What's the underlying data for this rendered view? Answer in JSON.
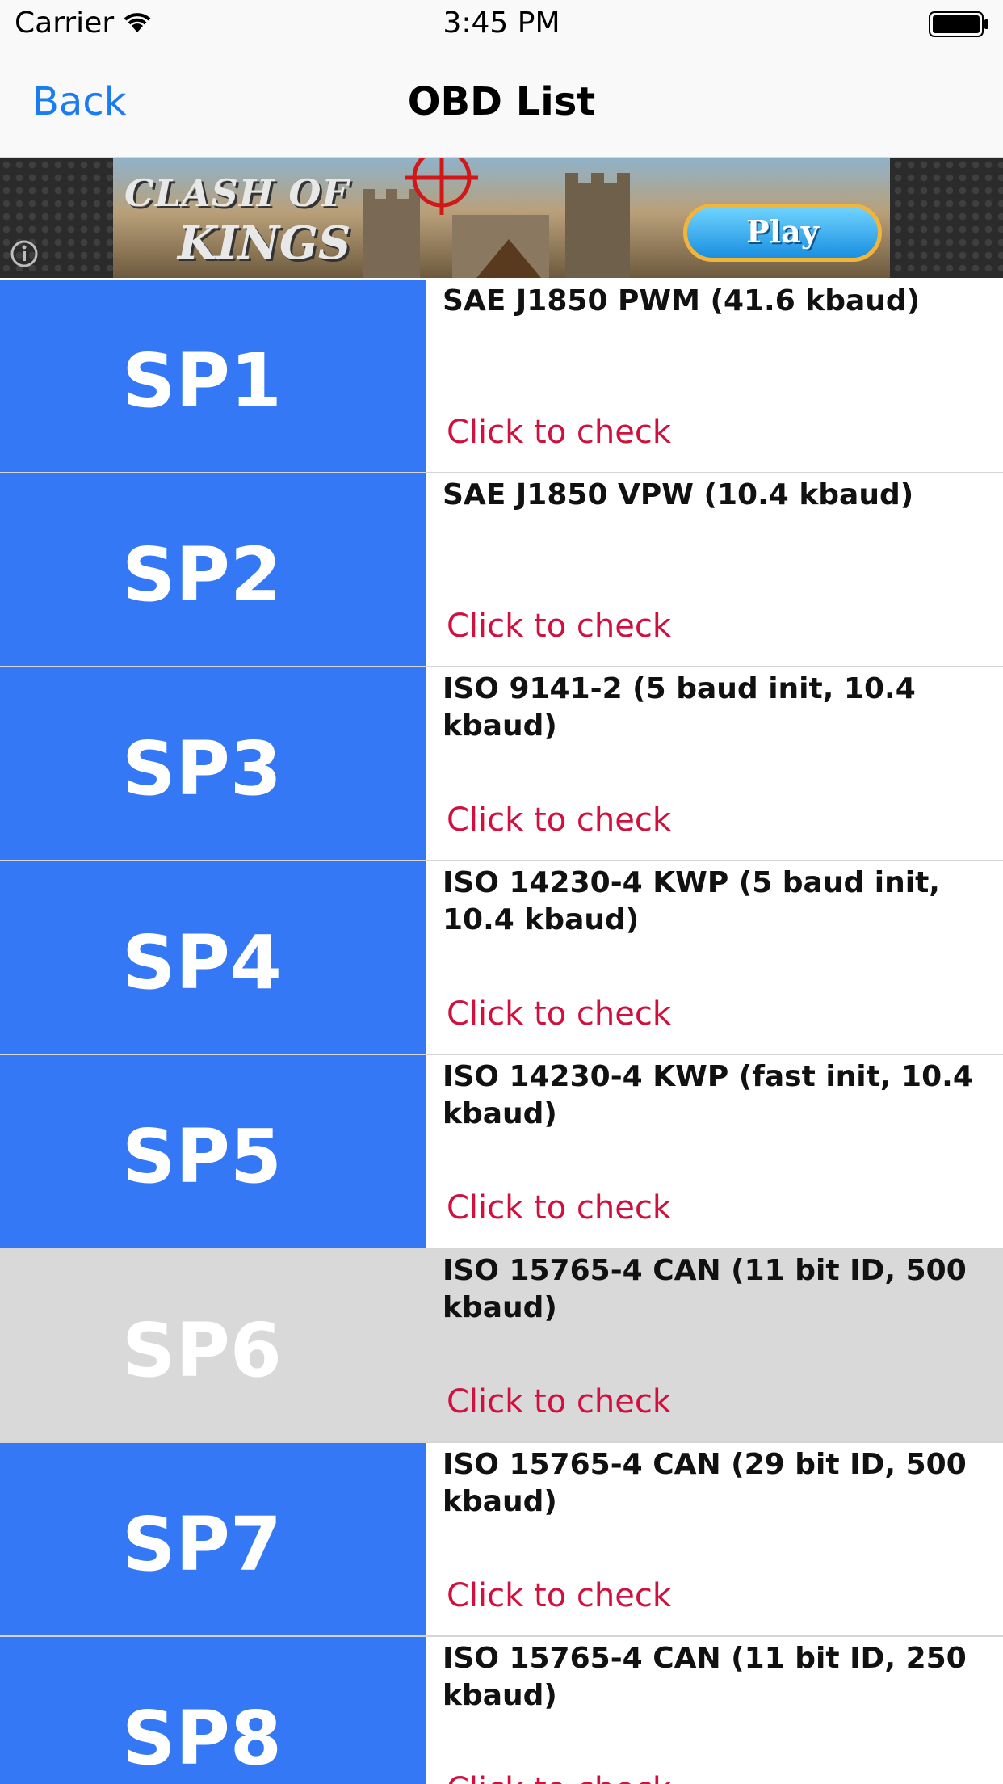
{
  "status_bar": {
    "carrier": "Carrier",
    "time": "3:45 PM"
  },
  "nav": {
    "back_label": "Back",
    "title": "OBD List"
  },
  "ad": {
    "logo_line1": "CLASH OF",
    "logo_line2": "KINGS",
    "play_label": "Play",
    "icons": {
      "info": "info-icon",
      "crosshair": "crosshair-icon"
    }
  },
  "list": {
    "action_label": "Click to check",
    "rows": [
      {
        "code": "SP1",
        "name": "SAE J1850 PWM (41.6 kbaud)",
        "selected": false
      },
      {
        "code": "SP2",
        "name": "SAE J1850 VPW (10.4 kbaud)",
        "selected": false
      },
      {
        "code": "SP3",
        "name": "ISO 9141-2 (5 baud init, 10.4 kbaud)",
        "selected": false
      },
      {
        "code": "SP4",
        "name": "ISO 14230-4 KWP (5 baud init, 10.4 kbaud)",
        "selected": false
      },
      {
        "code": "SP5",
        "name": "ISO 14230-4 KWP (fast init, 10.4 kbaud)",
        "selected": false
      },
      {
        "code": "SP6",
        "name": "ISO 15765-4 CAN (11 bit ID, 500 kbaud)",
        "selected": true
      },
      {
        "code": "SP7",
        "name": "ISO 15765-4 CAN (29 bit ID, 500 kbaud)",
        "selected": false
      },
      {
        "code": "SP8",
        "name": "ISO 15765-4 CAN (11 bit ID, 250 kbaud)",
        "selected": false
      }
    ]
  },
  "colors": {
    "tile": "#3478f6",
    "tile_selected": "#d9d9d9",
    "action_text": "#d0103e",
    "nav_tint": "#1a7cf2"
  }
}
